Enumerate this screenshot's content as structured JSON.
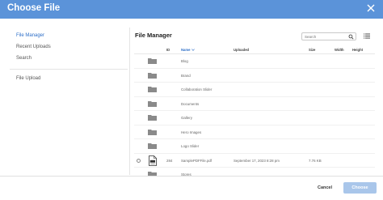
{
  "dialog": {
    "title": "Choose File"
  },
  "sidebar": {
    "items": [
      {
        "label": "File Manager",
        "active": true
      },
      {
        "label": "Recent Uploads"
      },
      {
        "label": "Search"
      },
      {
        "label": "File Upload"
      }
    ]
  },
  "main": {
    "title": "File Manager",
    "search_placeholder": "Search"
  },
  "table": {
    "columns": {
      "id": "ID",
      "name": "Name",
      "uploaded": "Uploaded",
      "size": "Size",
      "width": "Width",
      "height": "Height"
    },
    "rows": [
      {
        "type": "folder",
        "name": "Blog"
      },
      {
        "type": "folder",
        "name": "Brand"
      },
      {
        "type": "folder",
        "name": "Collaboration Slider"
      },
      {
        "type": "folder",
        "name": "Documents"
      },
      {
        "type": "folder",
        "name": "Gallery"
      },
      {
        "type": "folder",
        "name": "Hero Images"
      },
      {
        "type": "folder",
        "name": "Logo Slider"
      },
      {
        "type": "file",
        "id": "284",
        "name": "SamplePDFFile.pdf",
        "uploaded": "September 17, 2023 8:28 pm",
        "size": "7.76 KB"
      },
      {
        "type": "folder",
        "name": "Stores"
      }
    ]
  },
  "footer": {
    "cancel_label": "Cancel",
    "choose_label": "Choose"
  },
  "colors": {
    "header": "#5b93d9",
    "accent": "#2e6fc8",
    "choose_disabled": "#a9c6ea",
    "folder": "#8a8a8a"
  }
}
